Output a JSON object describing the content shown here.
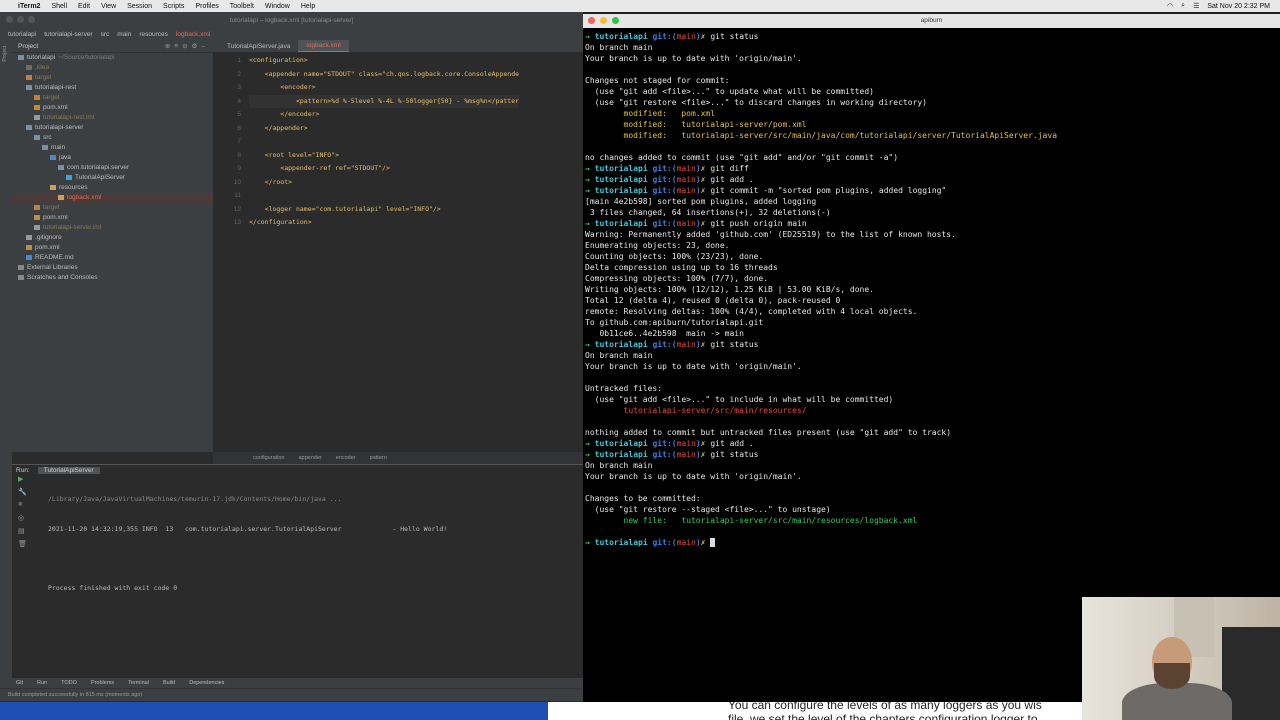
{
  "menubar": {
    "app": "iTerm2",
    "items": [
      "Shell",
      "Edit",
      "View",
      "Session",
      "Scripts",
      "Profiles",
      "Toolbelt",
      "Window",
      "Help"
    ],
    "clock": "Sat Nov 20  2:32 PM"
  },
  "ide": {
    "title": "tutorialapi – logback.xml [tutorialapi-server]",
    "breadcrumbs": [
      "tutorialapi",
      "tutorialapi-server",
      "src",
      "main",
      "resources",
      "logback.xml"
    ],
    "project_label": "Project",
    "tree": [
      {
        "label": "tutorialapi",
        "hint": "~/Source/tutorialapi"
      },
      {
        "label": ".idea"
      },
      {
        "label": "target"
      },
      {
        "label": "tutorialapi-rest"
      },
      {
        "label": "target"
      },
      {
        "label": "pom.xml"
      },
      {
        "label": "tutorialapi-rest.iml"
      },
      {
        "label": "tutorialapi-server"
      },
      {
        "label": "src"
      },
      {
        "label": "main"
      },
      {
        "label": "java"
      },
      {
        "label": "com.tutorialapi.server"
      },
      {
        "label": "TutorialApiServer"
      },
      {
        "label": "resources"
      },
      {
        "label": "logback.xml"
      },
      {
        "label": "target"
      },
      {
        "label": "pom.xml"
      },
      {
        "label": "tutorialapi-server.iml"
      },
      {
        "label": ".gitignore"
      },
      {
        "label": "pom.xml"
      },
      {
        "label": "README.md"
      },
      {
        "label": "External Libraries"
      },
      {
        "label": "Scratches and Consoles"
      }
    ],
    "tabs": [
      "TutorialApiServer.java",
      "logback.xml"
    ],
    "line_numbers": [
      "1",
      "2",
      "3",
      "4",
      "5",
      "6",
      "7",
      "8",
      "9",
      "10",
      "11",
      "12",
      "13"
    ],
    "code_lines": [
      "<configuration>",
      "    <appender name=\"STDOUT\" class=\"ch.qos.logback.core.ConsoleAppende",
      "        <encoder>",
      "            <pattern>%d %-5level %-4L %-50logger{50} - %msg%n</patter",
      "        </encoder>",
      "    </appender>",
      "",
      "    <root level=\"INFO\">",
      "        <appender-ref ref=\"STDOUT\"/>",
      "    </root>",
      "",
      "    <logger name=\"com.tutorialapi\" level=\"INFO\"/>",
      "</configuration>"
    ],
    "editor_breadcrumbs": [
      "configuration",
      "appender",
      "encoder",
      "pattern"
    ],
    "run": {
      "label": "Run:",
      "tab": "TutorialApiServer",
      "lines": [
        "/Library/Java/JavaVirtualMachines/temurin-17.jdk/Contents/Home/bin/java ...",
        "2021-11-20 14:32:19,355 INFO  13   com.tutorialapi.server.TutorialApiServer             - Hello World!",
        "",
        "Process finished with exit code 0"
      ]
    },
    "bottom_tabs": [
      "Git",
      "Run",
      "TODO",
      "Problems",
      "Terminal",
      "Build",
      "Dependencies"
    ],
    "status": "Build completed successfully in 815 ms (moments ago)"
  },
  "terminal": {
    "title": "apiburn",
    "prompt": {
      "arrow": "→",
      "dir": "tutorialapi",
      "git": "git:(",
      "branch": "main",
      "close": ")",
      "dirty": "✗"
    },
    "lines": [
      {
        "t": "prompt",
        "cmd": "git status"
      },
      {
        "t": "text",
        "s": "On branch main"
      },
      {
        "t": "text",
        "s": "Your branch is up to date with 'origin/main'."
      },
      {
        "t": "text",
        "s": ""
      },
      {
        "t": "text",
        "s": "Changes not staged for commit:"
      },
      {
        "t": "text",
        "s": "  (use \"git add <file>...\" to update what will be committed)"
      },
      {
        "t": "text",
        "s": "  (use \"git restore <file>...\" to discard changes in working directory)"
      },
      {
        "t": "yellow",
        "s": "        modified:   pom.xml"
      },
      {
        "t": "yellow",
        "s": "        modified:   tutorialapi-server/pom.xml"
      },
      {
        "t": "yellow",
        "s": "        modified:   tutorialapi-server/src/main/java/com/tutorialapi/server/TutorialApiServer.java"
      },
      {
        "t": "text",
        "s": ""
      },
      {
        "t": "text",
        "s": "no changes added to commit (use \"git add\" and/or \"git commit -a\")"
      },
      {
        "t": "prompt",
        "cmd": "git diff"
      },
      {
        "t": "prompt",
        "cmd": "git add ."
      },
      {
        "t": "prompt",
        "cmd": "git commit -m \"sorted pom plugins, added logging\""
      },
      {
        "t": "text",
        "s": "[main 4e2b598] sorted pom plugins, added logging"
      },
      {
        "t": "text",
        "s": " 3 files changed, 64 insertions(+), 32 deletions(-)"
      },
      {
        "t": "prompt",
        "cmd": "git push origin main"
      },
      {
        "t": "text",
        "s": "Warning: Permanently added 'github.com' (ED25519) to the list of known hosts."
      },
      {
        "t": "text",
        "s": "Enumerating objects: 23, done."
      },
      {
        "t": "text",
        "s": "Counting objects: 100% (23/23), done."
      },
      {
        "t": "text",
        "s": "Delta compression using up to 16 threads"
      },
      {
        "t": "text",
        "s": "Compressing objects: 100% (7/7), done."
      },
      {
        "t": "text",
        "s": "Writing objects: 100% (12/12), 1.25 KiB | 53.00 KiB/s, done."
      },
      {
        "t": "text",
        "s": "Total 12 (delta 4), reused 0 (delta 0), pack-reused 0"
      },
      {
        "t": "text",
        "s": "remote: Resolving deltas: 100% (4/4), completed with 4 local objects."
      },
      {
        "t": "text",
        "s": "To github.com:apiburn/tutorialapi.git"
      },
      {
        "t": "text",
        "s": "   0b11ce6..4e2b598  main -> main"
      },
      {
        "t": "prompt",
        "cmd": "git status"
      },
      {
        "t": "text",
        "s": "On branch main"
      },
      {
        "t": "text",
        "s": "Your branch is up to date with 'origin/main'."
      },
      {
        "t": "text",
        "s": ""
      },
      {
        "t": "text",
        "s": "Untracked files:"
      },
      {
        "t": "text",
        "s": "  (use \"git add <file>...\" to include in what will be committed)"
      },
      {
        "t": "red",
        "s": "        tutorialapi-server/src/main/resources/"
      },
      {
        "t": "text",
        "s": ""
      },
      {
        "t": "text",
        "s": "nothing added to commit but untracked files present (use \"git add\" to track)"
      },
      {
        "t": "prompt",
        "cmd": "git add ."
      },
      {
        "t": "prompt",
        "cmd": "git status"
      },
      {
        "t": "text",
        "s": "On branch main"
      },
      {
        "t": "text",
        "s": "Your branch is up to date with 'origin/main'."
      },
      {
        "t": "text",
        "s": ""
      },
      {
        "t": "text",
        "s": "Changes to be committed:"
      },
      {
        "t": "text",
        "s": "  (use \"git restore --staged <file>...\" to unstage)"
      },
      {
        "t": "green",
        "s": "        new file:   tutorialapi-server/src/main/resources/logback.xml"
      },
      {
        "t": "text",
        "s": ""
      },
      {
        "t": "prompt",
        "cmd": "",
        "cursor": true
      }
    ]
  },
  "caption": {
    "line1": "You can configure the levels of as many loggers as you wis",
    "line2": "file, we set the level of the chapters configuration logger to"
  }
}
